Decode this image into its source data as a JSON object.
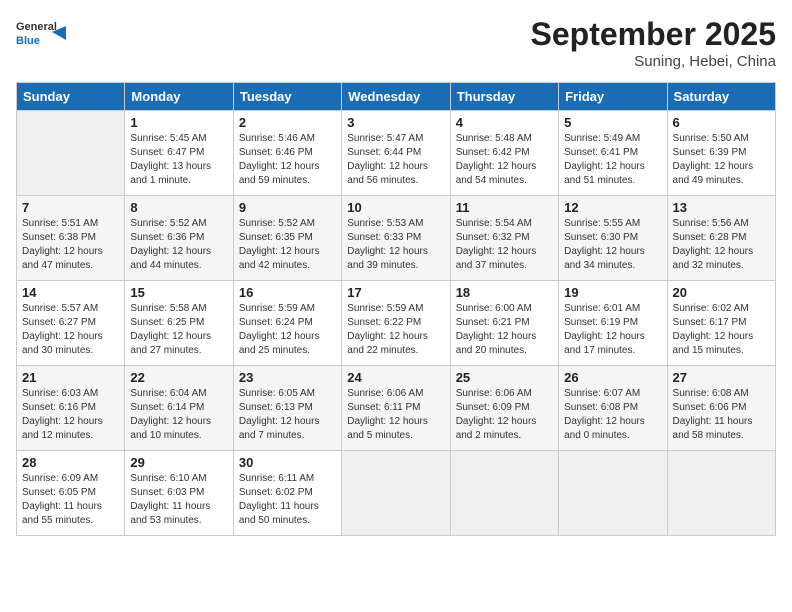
{
  "logo": {
    "general": "General",
    "blue": "Blue"
  },
  "title": "September 2025",
  "subtitle": "Suning, Hebei, China",
  "days_of_week": [
    "Sunday",
    "Monday",
    "Tuesday",
    "Wednesday",
    "Thursday",
    "Friday",
    "Saturday"
  ],
  "weeks": [
    [
      {
        "day": "",
        "sunrise": "",
        "sunset": "",
        "daylight": ""
      },
      {
        "day": "1",
        "sunrise": "Sunrise: 5:45 AM",
        "sunset": "Sunset: 6:47 PM",
        "daylight": "Daylight: 13 hours and 1 minute."
      },
      {
        "day": "2",
        "sunrise": "Sunrise: 5:46 AM",
        "sunset": "Sunset: 6:46 PM",
        "daylight": "Daylight: 12 hours and 59 minutes."
      },
      {
        "day": "3",
        "sunrise": "Sunrise: 5:47 AM",
        "sunset": "Sunset: 6:44 PM",
        "daylight": "Daylight: 12 hours and 56 minutes."
      },
      {
        "day": "4",
        "sunrise": "Sunrise: 5:48 AM",
        "sunset": "Sunset: 6:42 PM",
        "daylight": "Daylight: 12 hours and 54 minutes."
      },
      {
        "day": "5",
        "sunrise": "Sunrise: 5:49 AM",
        "sunset": "Sunset: 6:41 PM",
        "daylight": "Daylight: 12 hours and 51 minutes."
      },
      {
        "day": "6",
        "sunrise": "Sunrise: 5:50 AM",
        "sunset": "Sunset: 6:39 PM",
        "daylight": "Daylight: 12 hours and 49 minutes."
      }
    ],
    [
      {
        "day": "7",
        "sunrise": "Sunrise: 5:51 AM",
        "sunset": "Sunset: 6:38 PM",
        "daylight": "Daylight: 12 hours and 47 minutes."
      },
      {
        "day": "8",
        "sunrise": "Sunrise: 5:52 AM",
        "sunset": "Sunset: 6:36 PM",
        "daylight": "Daylight: 12 hours and 44 minutes."
      },
      {
        "day": "9",
        "sunrise": "Sunrise: 5:52 AM",
        "sunset": "Sunset: 6:35 PM",
        "daylight": "Daylight: 12 hours and 42 minutes."
      },
      {
        "day": "10",
        "sunrise": "Sunrise: 5:53 AM",
        "sunset": "Sunset: 6:33 PM",
        "daylight": "Daylight: 12 hours and 39 minutes."
      },
      {
        "day": "11",
        "sunrise": "Sunrise: 5:54 AM",
        "sunset": "Sunset: 6:32 PM",
        "daylight": "Daylight: 12 hours and 37 minutes."
      },
      {
        "day": "12",
        "sunrise": "Sunrise: 5:55 AM",
        "sunset": "Sunset: 6:30 PM",
        "daylight": "Daylight: 12 hours and 34 minutes."
      },
      {
        "day": "13",
        "sunrise": "Sunrise: 5:56 AM",
        "sunset": "Sunset: 6:28 PM",
        "daylight": "Daylight: 12 hours and 32 minutes."
      }
    ],
    [
      {
        "day": "14",
        "sunrise": "Sunrise: 5:57 AM",
        "sunset": "Sunset: 6:27 PM",
        "daylight": "Daylight: 12 hours and 30 minutes."
      },
      {
        "day": "15",
        "sunrise": "Sunrise: 5:58 AM",
        "sunset": "Sunset: 6:25 PM",
        "daylight": "Daylight: 12 hours and 27 minutes."
      },
      {
        "day": "16",
        "sunrise": "Sunrise: 5:59 AM",
        "sunset": "Sunset: 6:24 PM",
        "daylight": "Daylight: 12 hours and 25 minutes."
      },
      {
        "day": "17",
        "sunrise": "Sunrise: 5:59 AM",
        "sunset": "Sunset: 6:22 PM",
        "daylight": "Daylight: 12 hours and 22 minutes."
      },
      {
        "day": "18",
        "sunrise": "Sunrise: 6:00 AM",
        "sunset": "Sunset: 6:21 PM",
        "daylight": "Daylight: 12 hours and 20 minutes."
      },
      {
        "day": "19",
        "sunrise": "Sunrise: 6:01 AM",
        "sunset": "Sunset: 6:19 PM",
        "daylight": "Daylight: 12 hours and 17 minutes."
      },
      {
        "day": "20",
        "sunrise": "Sunrise: 6:02 AM",
        "sunset": "Sunset: 6:17 PM",
        "daylight": "Daylight: 12 hours and 15 minutes."
      }
    ],
    [
      {
        "day": "21",
        "sunrise": "Sunrise: 6:03 AM",
        "sunset": "Sunset: 6:16 PM",
        "daylight": "Daylight: 12 hours and 12 minutes."
      },
      {
        "day": "22",
        "sunrise": "Sunrise: 6:04 AM",
        "sunset": "Sunset: 6:14 PM",
        "daylight": "Daylight: 12 hours and 10 minutes."
      },
      {
        "day": "23",
        "sunrise": "Sunrise: 6:05 AM",
        "sunset": "Sunset: 6:13 PM",
        "daylight": "Daylight: 12 hours and 7 minutes."
      },
      {
        "day": "24",
        "sunrise": "Sunrise: 6:06 AM",
        "sunset": "Sunset: 6:11 PM",
        "daylight": "Daylight: 12 hours and 5 minutes."
      },
      {
        "day": "25",
        "sunrise": "Sunrise: 6:06 AM",
        "sunset": "Sunset: 6:09 PM",
        "daylight": "Daylight: 12 hours and 2 minutes."
      },
      {
        "day": "26",
        "sunrise": "Sunrise: 6:07 AM",
        "sunset": "Sunset: 6:08 PM",
        "daylight": "Daylight: 12 hours and 0 minutes."
      },
      {
        "day": "27",
        "sunrise": "Sunrise: 6:08 AM",
        "sunset": "Sunset: 6:06 PM",
        "daylight": "Daylight: 11 hours and 58 minutes."
      }
    ],
    [
      {
        "day": "28",
        "sunrise": "Sunrise: 6:09 AM",
        "sunset": "Sunset: 6:05 PM",
        "daylight": "Daylight: 11 hours and 55 minutes."
      },
      {
        "day": "29",
        "sunrise": "Sunrise: 6:10 AM",
        "sunset": "Sunset: 6:03 PM",
        "daylight": "Daylight: 11 hours and 53 minutes."
      },
      {
        "day": "30",
        "sunrise": "Sunrise: 6:11 AM",
        "sunset": "Sunset: 6:02 PM",
        "daylight": "Daylight: 11 hours and 50 minutes."
      },
      {
        "day": "",
        "sunrise": "",
        "sunset": "",
        "daylight": ""
      },
      {
        "day": "",
        "sunrise": "",
        "sunset": "",
        "daylight": ""
      },
      {
        "day": "",
        "sunrise": "",
        "sunset": "",
        "daylight": ""
      },
      {
        "day": "",
        "sunrise": "",
        "sunset": "",
        "daylight": ""
      }
    ]
  ]
}
